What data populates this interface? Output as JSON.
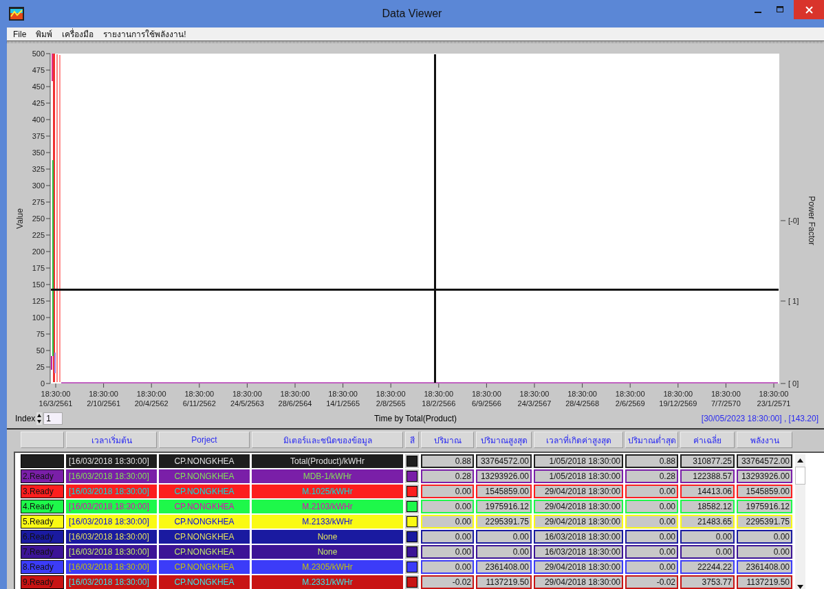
{
  "window": {
    "title": "Data Viewer"
  },
  "menu": [
    "File",
    "พิมพ์",
    "เครื่องมือ",
    "รายงานการใช้พลังงาน!"
  ],
  "chart": {
    "ylabel": "Value",
    "y2label": "Power Factor",
    "xlabel": "Time by Total(Product)",
    "yticks": [
      "500",
      "475",
      "450",
      "425",
      "400",
      "375",
      "350",
      "325",
      "300",
      "275",
      "250",
      "225",
      "200",
      "175",
      "150",
      "125",
      "100",
      "75",
      "50",
      "25",
      "0"
    ],
    "y2ticks": [
      "[-0]",
      "[ 1]",
      "[ 0]"
    ],
    "xticks": [
      {
        "time": "18:30:00",
        "date": "16/3/2561"
      },
      {
        "time": "18:30:00",
        "date": "2/10/2561"
      },
      {
        "time": "18:30:00",
        "date": "20/4/2562"
      },
      {
        "time": "18:30:00",
        "date": "6/11/2562"
      },
      {
        "time": "18:30:00",
        "date": "24/5/2563"
      },
      {
        "time": "18:30:00",
        "date": "28/6/2564"
      },
      {
        "time": "18:30:00",
        "date": "14/1/2565"
      },
      {
        "time": "18:30:00",
        "date": "2/8/2565"
      },
      {
        "time": "18:30:00",
        "date": "18/2/2566"
      },
      {
        "time": "18:30:00",
        "date": "6/9/2566"
      },
      {
        "time": "18:30:00",
        "date": "24/3/2567"
      },
      {
        "time": "18:30:00",
        "date": "28/4/2568"
      },
      {
        "time": "18:30:00",
        "date": "2/6/2569"
      },
      {
        "time": "18:30:00",
        "date": "19/12/2569"
      },
      {
        "time": "18:30:00",
        "date": "7/7/2570"
      },
      {
        "time": "18:30:00",
        "date": "23/1/2571"
      }
    ],
    "readout": "[30/05/2023 18:30:00] , [143.20]"
  },
  "index": {
    "label": "Index",
    "value": "1"
  },
  "table": {
    "columns": [
      "เวลาเริ่มต้น",
      "Porject",
      "มิเตอร์และชนิดของข้อมูล",
      "สี",
      "ปริมาณ",
      "ปริมาณสูงสุด",
      "เวลาที่เกิดค่าสูงสุด",
      "ปริมาณต่ำสุด",
      "ค่าเฉลี่ย",
      "พลังงาน"
    ],
    "rows": [
      {
        "color": "#1e1e1e",
        "start": "[16/03/2018 18:30:00]",
        "project": "CP.NONGKHEA",
        "meter": "Total(Product)/kWHr",
        "qty": "0.88",
        "max": "33764572.00",
        "max_time": "1/05/2018 18:30:00",
        "min": "0.88",
        "avg": "310877.25",
        "energy": "33764572.00"
      },
      {
        "status": "2.Ready",
        "color": "#7a1fa8",
        "start": "[16/03/2018 18:30:00]",
        "project": "CP.NONGKHEA",
        "meter": "MDB-1/kWHr",
        "qty": "0.28",
        "max": "13293926.00",
        "max_time": "1/05/2018 18:30:00",
        "min": "0.28",
        "avg": "122388.57",
        "energy": "13293926.00"
      },
      {
        "status": "3.Ready",
        "color": "#fc1e1e",
        "start": "[16/03/2018 18:30:00]",
        "project": "CP.NONGKHEA",
        "meter": "M.1025/kWHr",
        "qty": "0.00",
        "max": "1545859.00",
        "max_time": "29/04/2018 18:30:00",
        "min": "0.00",
        "avg": "14413.06",
        "energy": "1545859.00"
      },
      {
        "status": "4.Ready",
        "color": "#1ef84a",
        "start": "[16/03/2018 18:30:00]",
        "project": "CP.NONGKHEA",
        "meter": "M.2103/kWHr",
        "qty": "0.00",
        "max": "1975916.12",
        "max_time": "29/04/2018 18:30:00",
        "min": "0.00",
        "avg": "18582.12",
        "energy": "1975916.12"
      },
      {
        "status": "5.Ready",
        "color": "#fafa14",
        "start": "[16/03/2018 18:30:00]",
        "project": "CP.NONGKHEA",
        "meter": "M.2133/kWHr",
        "qty": "0.00",
        "max": "2295391.75",
        "max_time": "29/04/2018 18:30:00",
        "min": "0.00",
        "avg": "21483.65",
        "energy": "2295391.75"
      },
      {
        "status": "6.Ready",
        "color": "#1a1aa0",
        "start": "[16/03/2018 18:30:00]",
        "project": "CP.NONGKHEA",
        "meter": "None",
        "qty": "0.00",
        "max": "0.00",
        "max_time": "16/03/2018 18:30:00",
        "min": "0.00",
        "avg": "0.00",
        "energy": "0.00"
      },
      {
        "status": "7.Ready",
        "color": "#3c1496",
        "start": "[16/03/2018 18:30:00]",
        "project": "CP.NONGKHEA",
        "meter": "None",
        "qty": "0.00",
        "max": "0.00",
        "max_time": "16/03/2018 18:30:00",
        "min": "0.00",
        "avg": "0.00",
        "energy": "0.00"
      },
      {
        "status": "8.Ready",
        "color": "#3c3cf8",
        "start": "[16/03/2018 18:30:00]",
        "project": "CP.NONGKHEA",
        "meter": "M.2305/kWHr",
        "qty": "0.00",
        "max": "2361408.00",
        "max_time": "29/04/2018 18:30:00",
        "min": "0.00",
        "avg": "22244.22",
        "energy": "2361408.00"
      },
      {
        "status": "9.Ready",
        "color": "#c81414",
        "start": "[16/03/2018 18:30:00]",
        "project": "CP.NONGKHEA",
        "meter": "M.2331/kWHr",
        "qty": "-0.02",
        "max": "1137219.50",
        "max_time": "29/04/2018 18:30:00",
        "min": "-0.02",
        "avg": "3753.77",
        "energy": "1137219.50"
      }
    ]
  }
}
